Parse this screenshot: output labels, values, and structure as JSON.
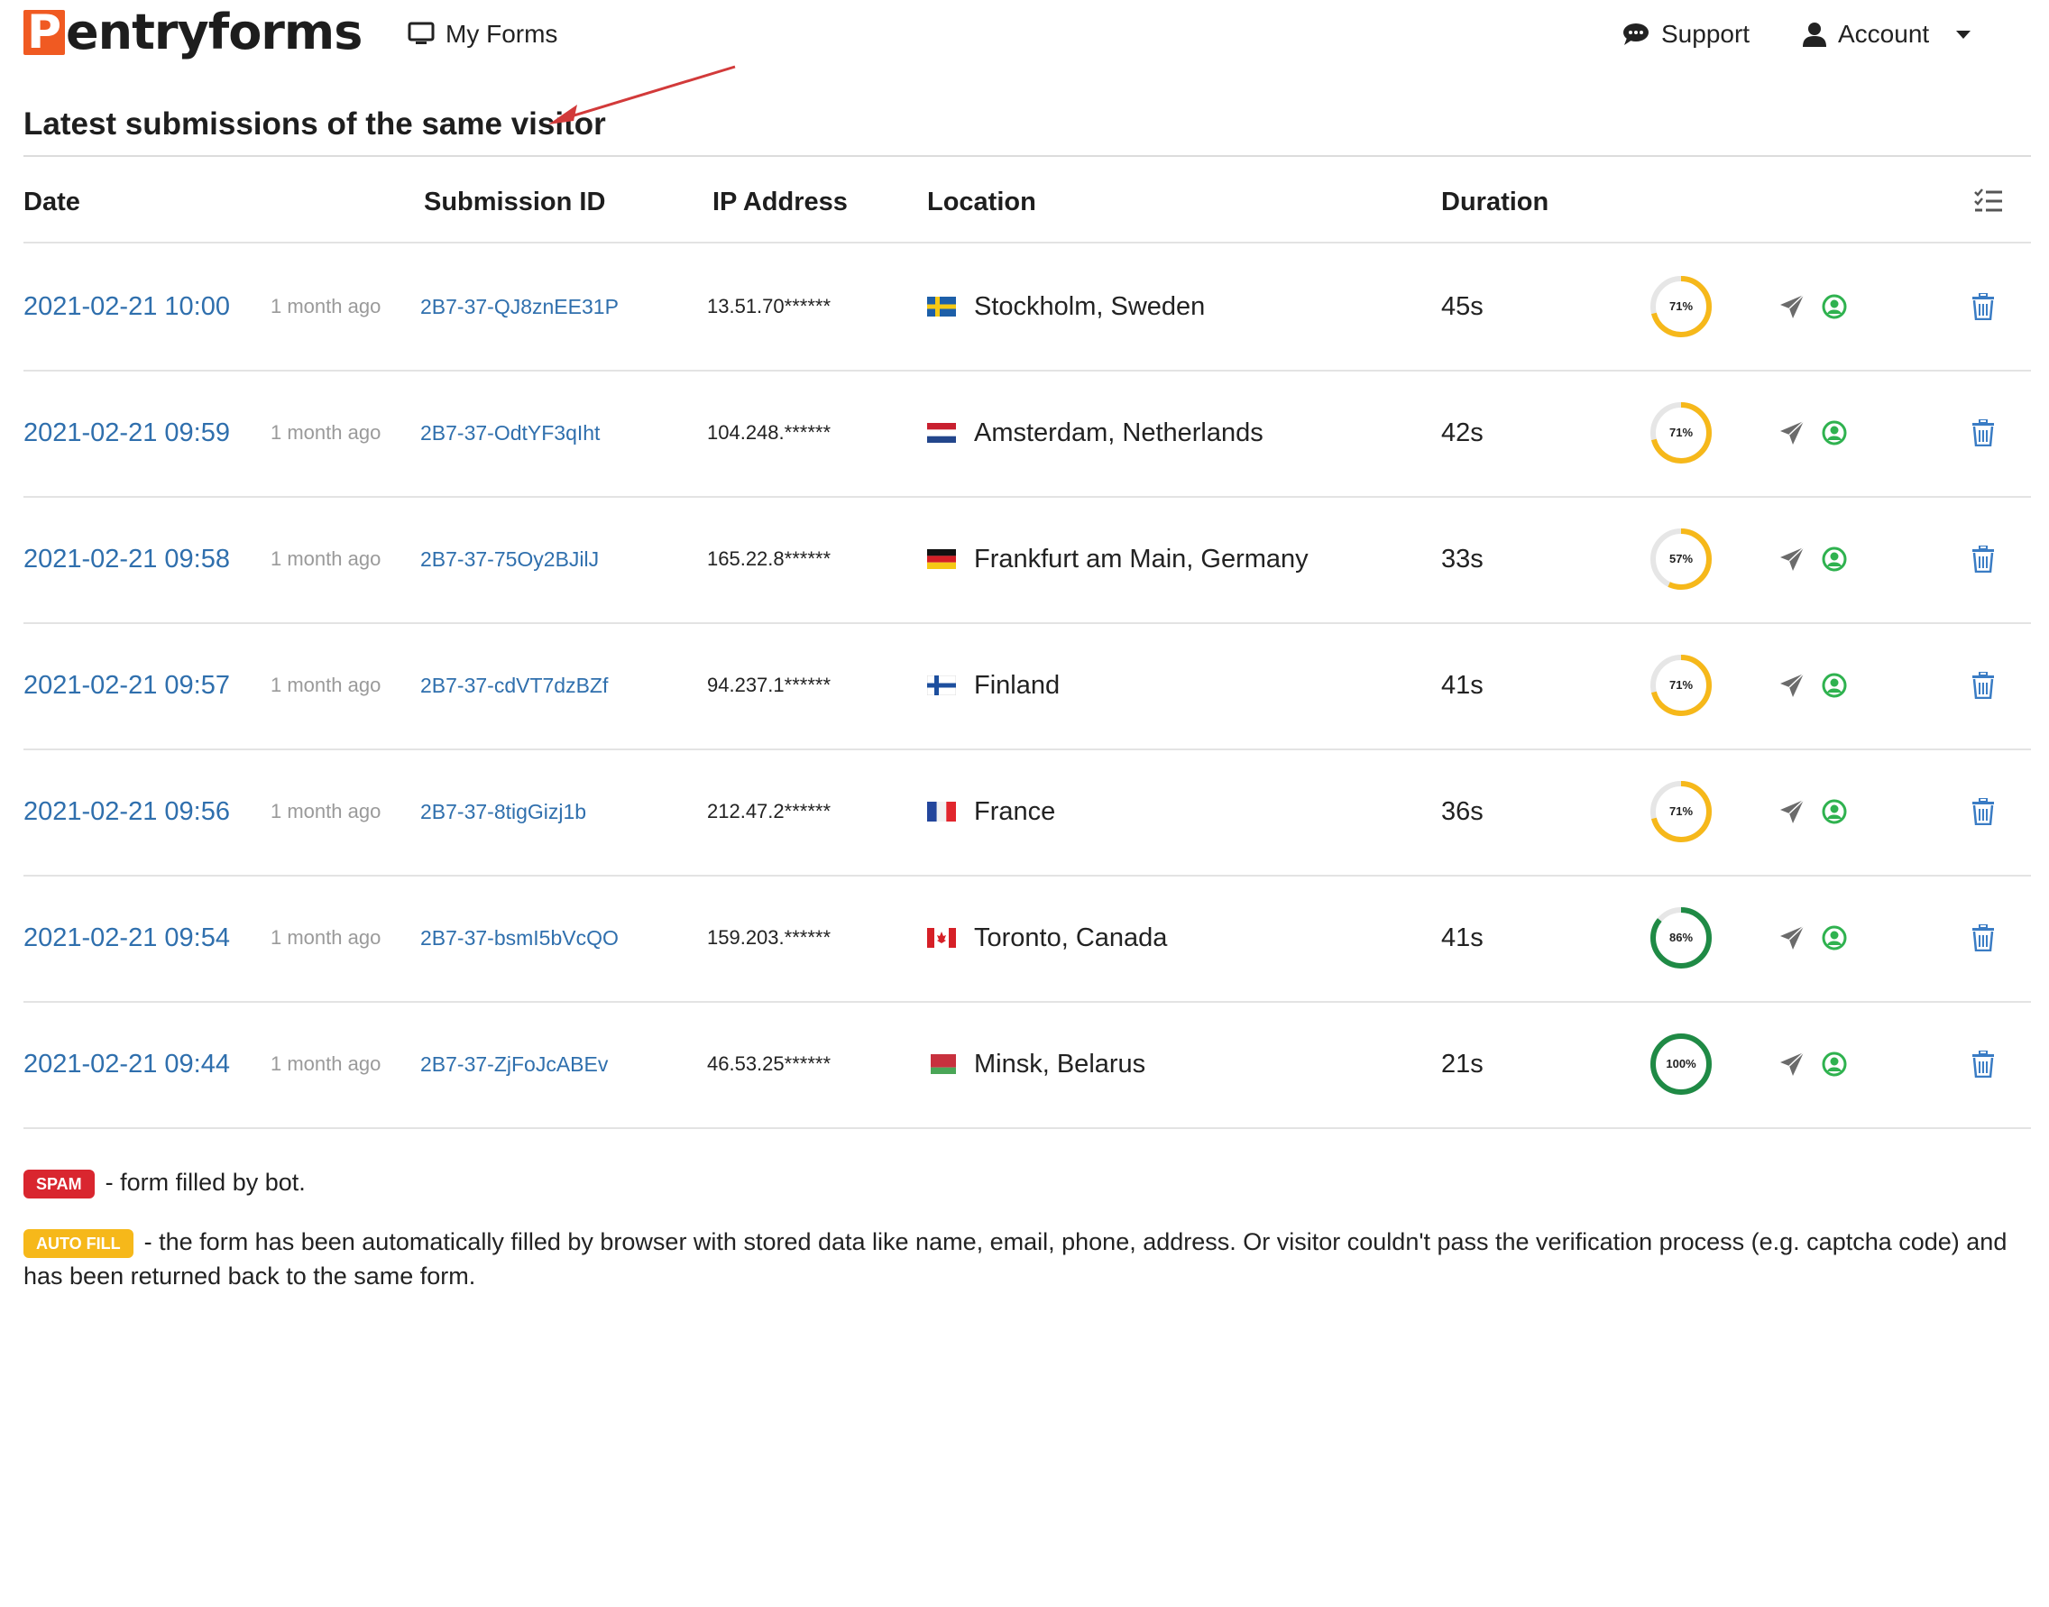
{
  "brand": {
    "logo_initial": "P",
    "logo_rest": "entryforms",
    "logo_color": "#f05a22"
  },
  "nav": {
    "my_forms": "My Forms",
    "support": "Support",
    "account": "Account"
  },
  "page": {
    "title": "Latest submissions of the same visitor"
  },
  "table": {
    "columns": {
      "date": "Date",
      "submission_id": "Submission ID",
      "ip_address": "IP Address",
      "location": "Location",
      "duration": "Duration"
    },
    "rows": [
      {
        "date": "2021-02-21 10:00",
        "ago": "1 month ago",
        "id": "2B7-37-QJ8znEE31P",
        "ip": "13.51.70******",
        "flag": "sweden",
        "location": "Stockholm, Sweden",
        "duration": "45s",
        "score": "71%",
        "score_value": 71
      },
      {
        "date": "2021-02-21 09:59",
        "ago": "1 month ago",
        "id": "2B7-37-OdtYF3qIht",
        "ip": "104.248.******",
        "flag": "netherlands",
        "location": "Amsterdam, Netherlands",
        "duration": "42s",
        "score": "71%",
        "score_value": 71
      },
      {
        "date": "2021-02-21 09:58",
        "ago": "1 month ago",
        "id": "2B7-37-75Oy2BJilJ",
        "ip": "165.22.8******",
        "flag": "germany",
        "location": "Frankfurt am Main, Germany",
        "duration": "33s",
        "score": "57%",
        "score_value": 57
      },
      {
        "date": "2021-02-21 09:57",
        "ago": "1 month ago",
        "id": "2B7-37-cdVT7dzBZf",
        "ip": "94.237.1******",
        "flag": "finland",
        "location": "Finland",
        "duration": "41s",
        "score": "71%",
        "score_value": 71
      },
      {
        "date": "2021-02-21 09:56",
        "ago": "1 month ago",
        "id": "2B7-37-8tigGizj1b",
        "ip": "212.47.2******",
        "flag": "france",
        "location": "France",
        "duration": "36s",
        "score": "71%",
        "score_value": 71
      },
      {
        "date": "2021-02-21 09:54",
        "ago": "1 month ago",
        "id": "2B7-37-bsmI5bVcQO",
        "ip": "159.203.******",
        "flag": "canada",
        "location": "Toronto, Canada",
        "duration": "41s",
        "score": "86%",
        "score_value": 86
      },
      {
        "date": "2021-02-21 09:44",
        "ago": "1 month ago",
        "id": "2B7-37-ZjFoJcABEv",
        "ip": "46.53.25******",
        "flag": "belarus",
        "location": "Minsk, Belarus",
        "duration": "21s",
        "score": "100%",
        "score_value": 100
      }
    ]
  },
  "legend": {
    "spam_badge": "SPAM",
    "spam_text": "- form filled by bot.",
    "autofill_badge": "AUTO FILL",
    "autofill_text": "- the form has been automatically filled by browser with stored data like name, email, phone, address. Or visitor couldn't pass the verification process (e.g. captcha code) and has been returned back to the same form."
  },
  "colors": {
    "link": "#2f6fad",
    "score_mid": "#f6b81a",
    "score_high": "#1f8a45",
    "user_icon": "#2fb24f",
    "delete_icon": "#3a7cc4",
    "spam": "#d9262f",
    "autofill": "#f6b81a",
    "annotation_arrow": "#d23a3a"
  }
}
